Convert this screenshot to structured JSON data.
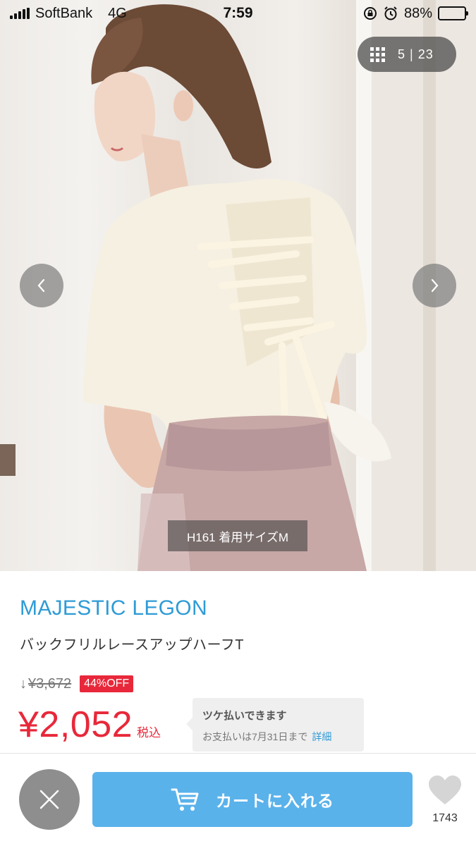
{
  "status_bar": {
    "carrier": "SoftBank",
    "network": "4G",
    "time": "7:59",
    "battery": "88%"
  },
  "gallery": {
    "current": "5",
    "total": "23",
    "caption": "H161 着用サイズM"
  },
  "product": {
    "brand": "MAJESTIC LEGON",
    "name": "バックフリルレースアップハーフT",
    "old_price_arrow": "↓",
    "old_price": "¥3,672",
    "discount": "44%OFF",
    "price": "¥2,052",
    "tax_label": "税込"
  },
  "payment_tip": {
    "title": "ツケ払いできます",
    "subtitle": "お支払いは7月31日まで",
    "detail_link": "詳細"
  },
  "bottom_bar": {
    "cart_label": "カートに入れる",
    "favorite_count": "1743"
  },
  "colors": {
    "brand_blue": "#2e9bd6",
    "sale_red": "#e8283a",
    "cart_blue": "#5ab2ea",
    "close_gray": "#8e8e8e"
  }
}
